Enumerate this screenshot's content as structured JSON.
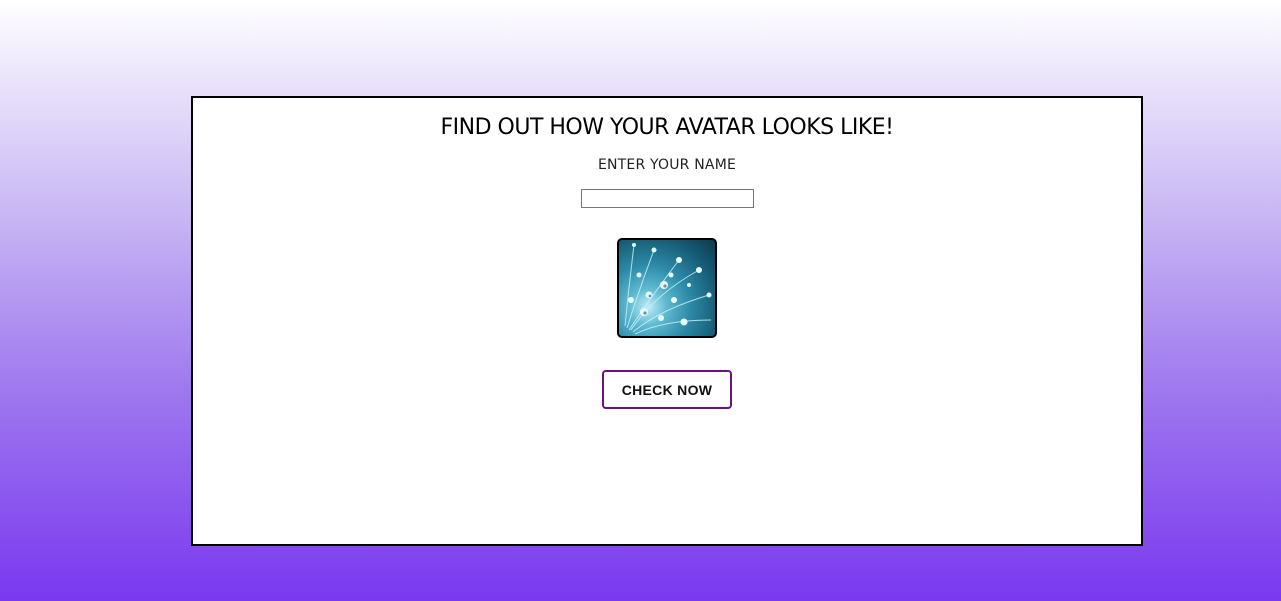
{
  "card": {
    "title": "FIND OUT HOW YOUR AVATAR LOOKS LIKE!",
    "prompt": "ENTER YOUR NAME",
    "name_input": {
      "value": "",
      "placeholder": ""
    },
    "avatar_image": "water-droplets-image",
    "check_button_label": "CHECK NOW"
  },
  "colors": {
    "background_top": "#ffffff",
    "background_bottom": "#7a38ef",
    "button_border": "#6c127f",
    "card_border": "#000000"
  }
}
